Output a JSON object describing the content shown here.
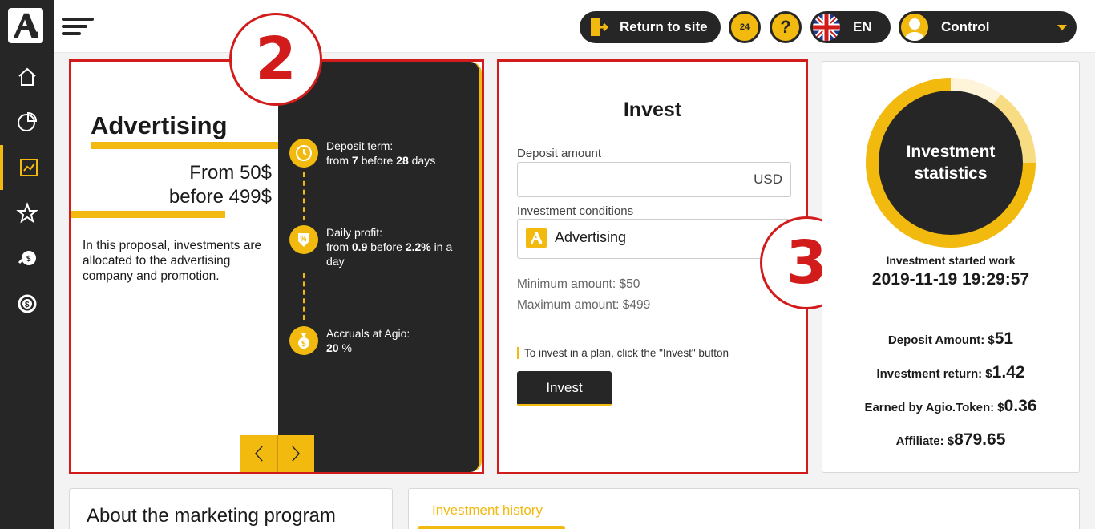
{
  "header": {
    "return_label": "Return to site",
    "support_label": "24",
    "help_label": "?",
    "lang_label": "EN",
    "user_label": "Control"
  },
  "badges": {
    "plan_number": "2",
    "invest_number": "3"
  },
  "plan": {
    "title": "Advertising",
    "from_line": "From 50$",
    "before_line": "before 499$",
    "description": "In this proposal, investments are allocated to the advertising company and promotion.",
    "features": [
      {
        "label": "Deposit term:",
        "pre": "from ",
        "v1": "7",
        "mid": " before ",
        "v2": "28",
        "post": " days"
      },
      {
        "label": "Daily profit:",
        "pre": "from ",
        "v1": "0.9",
        "mid": " before ",
        "v2": "2.2%",
        "post": " in a day"
      },
      {
        "label": "Accruals at Agio:",
        "pre": "",
        "v1": "20",
        "mid": " %",
        "v2": "",
        "post": ""
      }
    ]
  },
  "invest": {
    "title": "Invest",
    "deposit_label": "Deposit amount",
    "deposit_value": "",
    "deposit_unit": "USD",
    "conditions_label": "Investment conditions",
    "conditions_value": "Advertising",
    "min_amount": "Minimum amount: $50",
    "max_amount": "Maximum amount: $499",
    "hint": "To invest in a plan, click the \"Invest\" button",
    "button_label": "Invest"
  },
  "stats": {
    "donut_title_1": "Investment",
    "donut_title_2": "statistics",
    "started_label": "Investment started work",
    "started_value": "2019-11-19 19:29:57",
    "items": [
      {
        "label": "Deposit Amount: $",
        "value": "51"
      },
      {
        "label": "Investment return: $",
        "value": "1.42"
      },
      {
        "label": "Earned by Agio.Token: $",
        "value": "0.36"
      },
      {
        "label": "Affiliate: $",
        "value": "879.65"
      }
    ]
  },
  "bottom": {
    "about_title": "About the marketing program",
    "history_tab": "Investment history"
  },
  "colors": {
    "accent": "#f2b90f",
    "dark": "#262626",
    "highlight": "#d21b1b"
  }
}
